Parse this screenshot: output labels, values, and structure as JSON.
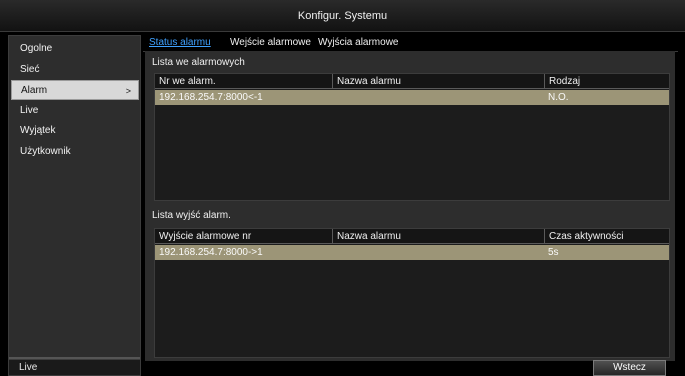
{
  "window": {
    "title": "Konfigur. Systemu"
  },
  "sidebar": {
    "items": [
      {
        "label": "Ogolne",
        "active": false
      },
      {
        "label": "Sieć",
        "active": false
      },
      {
        "label": "Alarm",
        "active": true
      },
      {
        "label": "Live",
        "active": false
      },
      {
        "label": "Wyjątek",
        "active": false
      },
      {
        "label": "Użytkownik",
        "active": false
      }
    ],
    "active_chevron": ">",
    "footer_label": "Live"
  },
  "tabs": [
    {
      "label": "Status alarmu",
      "active": true
    },
    {
      "label": "Wejście alarmowe",
      "active": false
    },
    {
      "label": "Wyjścia alarmowe",
      "active": false
    }
  ],
  "inputs_panel": {
    "title": "Lista we alarmowych",
    "columns": [
      "Nr we alarm.",
      "Nazwa alarmu",
      "Rodzaj"
    ],
    "rows": [
      [
        "192.168.254.7:8000<-1",
        "",
        "N.O."
      ]
    ]
  },
  "outputs_panel": {
    "title": "Lista wyjść alarm.",
    "columns": [
      "Wyjście alarmowe nr",
      "Nazwa alarmu",
      "Czas aktywności"
    ],
    "rows": [
      [
        "192.168.254.7:8000->1",
        "",
        "5s"
      ]
    ]
  },
  "footer": {
    "back_label": "Wstecz"
  },
  "colors": {
    "selected_row": "#9c9577",
    "active_tab": "#3fa1ff",
    "panel": "#2d2d2d"
  }
}
